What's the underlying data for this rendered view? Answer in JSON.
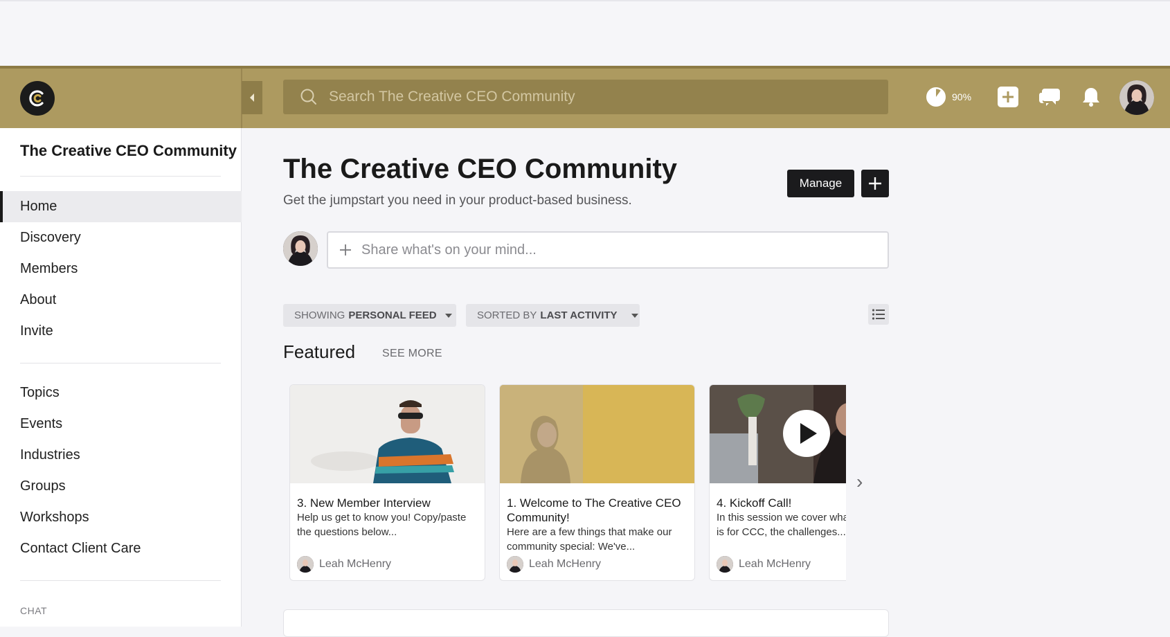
{
  "topbar": {
    "search_placeholder": "Search The Creative CEO Community",
    "progress_value": 90,
    "progress_text": "90%",
    "accent_color": "#ad9a60",
    "icons": [
      "logo-icon",
      "collapse-icon",
      "search-icon",
      "progress-icon",
      "add-icon",
      "chat-icon",
      "bell-icon",
      "user-avatar"
    ]
  },
  "sidebar": {
    "title": "The Creative CEO Community",
    "primary_nav": [
      {
        "label": "Home",
        "active": true
      },
      {
        "label": "Discovery"
      },
      {
        "label": "Members"
      },
      {
        "label": "About"
      },
      {
        "label": "Invite"
      }
    ],
    "secondary_nav": [
      {
        "label": "Topics"
      },
      {
        "label": "Events"
      },
      {
        "label": "Industries"
      },
      {
        "label": "Groups"
      },
      {
        "label": "Workshops"
      },
      {
        "label": "Contact Client Care"
      }
    ],
    "chat_label": "CHAT"
  },
  "main": {
    "title": "The Creative CEO Community",
    "subtitle": "Get the jumpstart you need in your product-based business.",
    "manage_label": "Manage",
    "composer_placeholder": "Share what's on your mind...",
    "feed_filter": {
      "prefix": "SHOWING",
      "value": "PERSONAL FEED"
    },
    "sort_filter": {
      "prefix": "SORTED BY",
      "value": "LAST ACTIVITY"
    },
    "featured_label": "Featured",
    "see_more_label": "SEE MORE",
    "cards": [
      {
        "title": "3. New Member Interview",
        "body": "Help us get to know you! Copy/paste the questions below...",
        "author": "Leah McHenry"
      },
      {
        "title": "1. Welcome to The Creative CEO Community!",
        "body": "Here are a few things that make our community special: We've...",
        "author": "Leah McHenry"
      },
      {
        "title": "4. Kickoff Call!",
        "body": "In this session we cover what the vision is for CCC, the challenges...",
        "author": "Leah McHenry"
      }
    ],
    "next_glyph": "›"
  }
}
